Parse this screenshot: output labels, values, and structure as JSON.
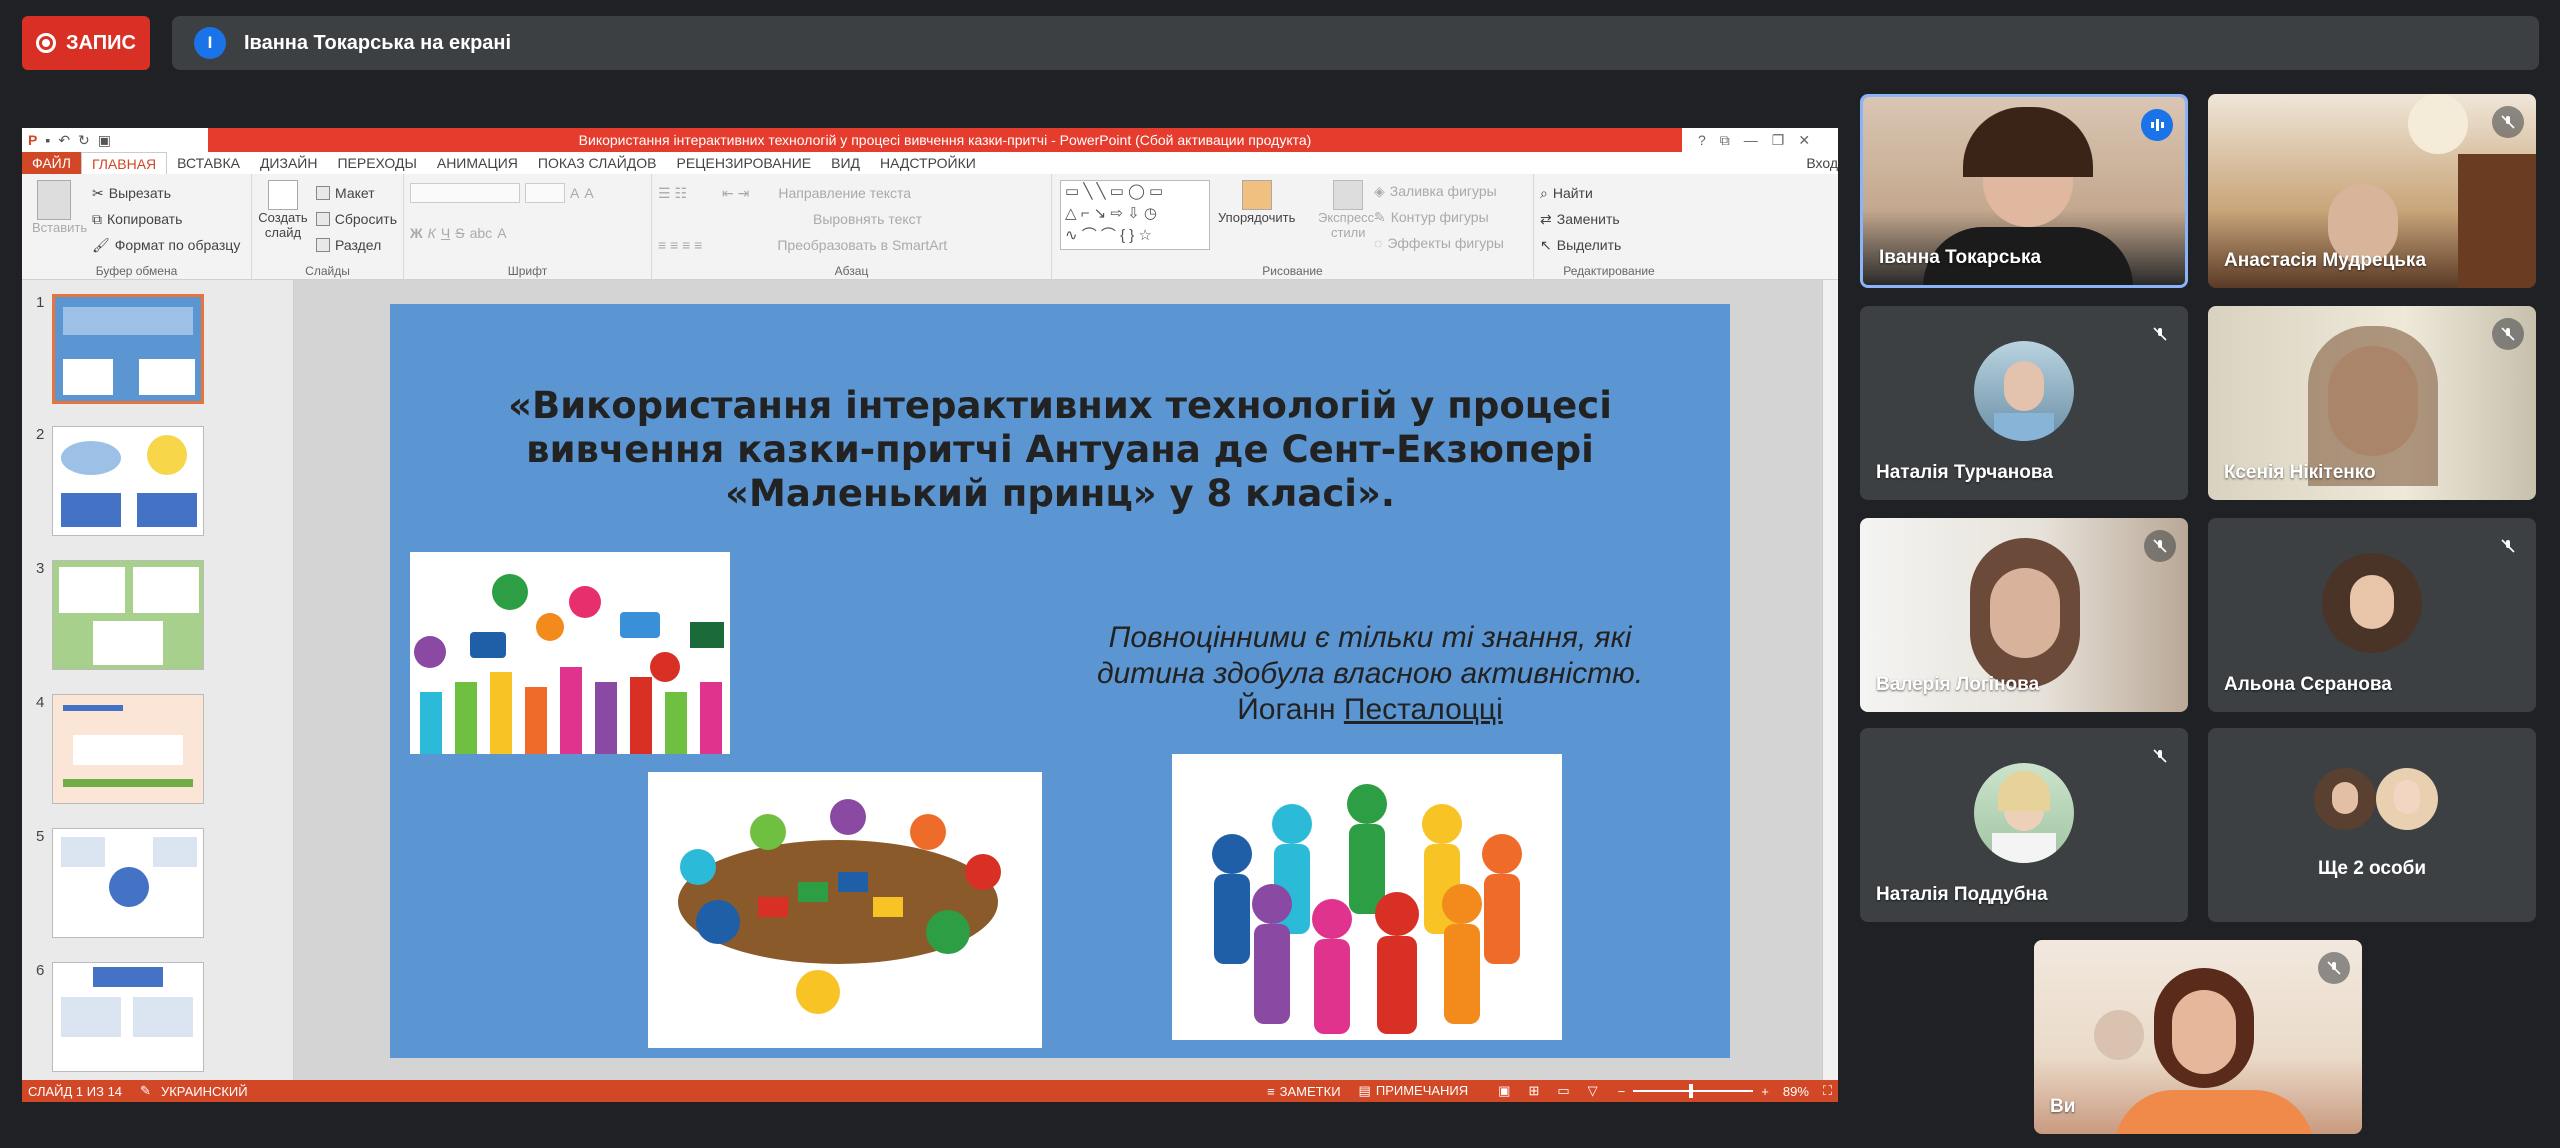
{
  "meet": {
    "record_label": "ЗАПИС",
    "presenter_initial": "І",
    "presenter_banner": "Іванна Токарська на екрані"
  },
  "ppt": {
    "window_title": "Використання інтерактивних технологій у процесі вивчення казки-притчі - PowerPoint (Сбой активации продукта)",
    "title_buttons": [
      "?",
      "⧉",
      "—",
      "❐",
      "✕"
    ],
    "tabs": [
      "ФАЙЛ",
      "ГЛАВНАЯ",
      "ВСТАВКА",
      "ДИЗАЙН",
      "ПЕРЕХОДЫ",
      "АНИМАЦИЯ",
      "ПОКАЗ СЛАЙДОВ",
      "РЕЦЕНЗИРОВАНИЕ",
      "ВИД",
      "НАДСТРОЙКИ"
    ],
    "signin": "Вход",
    "ribbon": {
      "clipboard": {
        "paste": "Вставить",
        "cut": "Вырезать",
        "copy": "Копировать",
        "format": "Формат по образцу",
        "label": "Буфер обмена"
      },
      "slides": {
        "create": "Создать",
        "slide": "слайд",
        "layout": "Макет",
        "reset": "Сбросить",
        "section": "Раздел",
        "label": "Слайды"
      },
      "font": {
        "bold": "Ж",
        "italic": "К",
        "underline": "Ч",
        "strike": "S",
        "shadow": "abc",
        "label": "Шрифт"
      },
      "paragraph": {
        "direction": "Направление текста",
        "align": "Выровнять текст",
        "smartart": "Преобразовать в SmartArt",
        "label": "Абзац"
      },
      "drawing": {
        "arrange": "Упорядочить",
        "styles": "Экспресс-",
        "styles2": "стили",
        "fill": "Заливка фигуры",
        "outline": "Контур фигуры",
        "effects": "Эффекты фигуры",
        "label": "Рисование"
      },
      "editing": {
        "find": "Найти",
        "replace": "Заменить",
        "select": "Выделить",
        "label": "Редактирование"
      }
    },
    "slide_numbers": [
      "1",
      "2",
      "3",
      "4",
      "5",
      "6"
    ],
    "slide": {
      "title_lines": [
        "«Використання інтерактивних технологій у процесі",
        "вивчення казки-притчі Антуана де Сент-Екзюпері",
        "«Маленький принц» у 8 класі»."
      ],
      "quote_line1": "Повноцінними є тільки ті знання, які",
      "quote_line2": "дитина здобула власною активністю.",
      "author_first": "Йоганн ",
      "author_last": "Песталоцці"
    },
    "status": {
      "slide_of": "СЛАЙД 1 ИЗ 14",
      "language": "УКРАИНСКИЙ",
      "notes": "ЗАМЕТКИ",
      "comments": "ПРИМЕЧАНИЯ",
      "zoom": "89%"
    }
  },
  "participants": [
    {
      "name": "Іванна Токарська",
      "state": "speaking"
    },
    {
      "name": "Анастасія Мудрецька",
      "state": "muted"
    },
    {
      "name": "Наталія Турчанова",
      "state": "muted"
    },
    {
      "name": "Ксенія Нікітенко",
      "state": "muted"
    },
    {
      "name": "Валерія Логінова",
      "state": "muted"
    },
    {
      "name": "Альона Сєранова",
      "state": "muted"
    },
    {
      "name": "Наталія Поддубна",
      "state": "muted"
    },
    {
      "name": "Ще 2 особи",
      "state": "group"
    },
    {
      "name": "Ви",
      "state": "muted"
    }
  ],
  "colors": {
    "record": "#d93025",
    "ppt_accent": "#d24726",
    "slide_bg": "#5b96d3",
    "speaking": "#1a73e8"
  }
}
